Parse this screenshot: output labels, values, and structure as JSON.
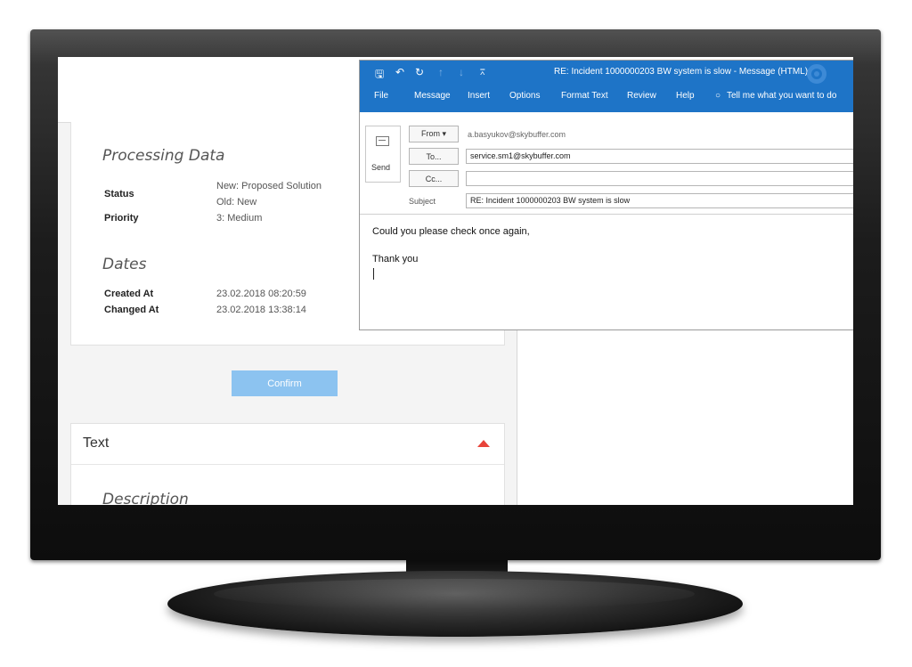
{
  "processing": {
    "title": "Processing Data",
    "status_label": "Status",
    "status_new": "New: Proposed Solution",
    "status_old": "Old: New",
    "priority_label": "Priority",
    "priority_value": "3: Medium"
  },
  "dates": {
    "title": "Dates",
    "created_label": "Created At",
    "created_value": "23.02.2018 08:20:59",
    "changed_label": "Changed At",
    "changed_value": "23.02.2018 13:38:14"
  },
  "confirm_label": "Confirm",
  "text_panel": {
    "title": "Text",
    "description_title": "Description"
  },
  "outlook": {
    "title": "RE: Incident 1000000203  BW system is slow  -  Message (HTML)",
    "menu": [
      "File",
      "Message",
      "Insert",
      "Options",
      "Format Text",
      "Review",
      "Help",
      "Tell me what you want to do"
    ],
    "send_label": "Send",
    "from_label": "From ▾",
    "from_value": "a.basyukov@skybuffer.com",
    "to_label": "To...",
    "to_value": "service.sm1@skybuffer.com",
    "cc_label": "Cc...",
    "cc_value": "",
    "subject_label": "Subject",
    "subject_value": "RE: Incident 1000000203  BW system is slow",
    "body_line1": "Could you please check once again,",
    "body_line2": "Thank you"
  },
  "colors": {
    "ribbon": "#1e74c7",
    "confirm": "#8cc3f0",
    "collapse_arrow": "#e8443a"
  }
}
